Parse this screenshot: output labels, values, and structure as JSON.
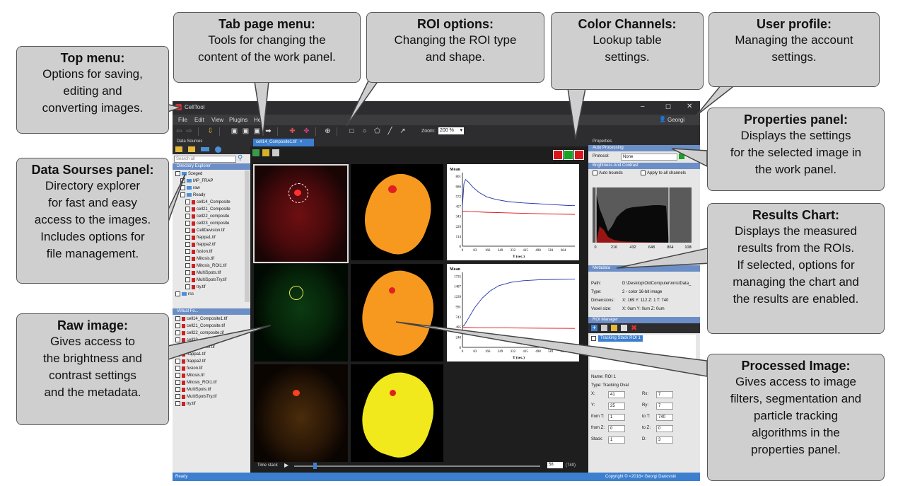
{
  "callouts": {
    "top_menu": {
      "title": "Top menu:",
      "lines": [
        "Options for saving,",
        "editing and",
        "converting images."
      ]
    },
    "tab_menu": {
      "title": "Tab page menu:",
      "lines": [
        "Tools for changing the",
        "content of the work panel."
      ]
    },
    "roi": {
      "title": "ROI options:",
      "lines": [
        "Changing the ROI type",
        "and shape."
      ]
    },
    "color": {
      "title": "Color Channels:",
      "lines": [
        "Lookup table",
        "settings."
      ]
    },
    "user": {
      "title": "User profile:",
      "lines": [
        "Managing the account",
        "settings."
      ]
    },
    "props": {
      "title": "Properties panel:",
      "lines": [
        "Displays the settings",
        "for the selected image in",
        "the work panel."
      ]
    },
    "datasrc": {
      "title": "Data Sourses panel:",
      "lines": [
        "Directory explorer",
        "for fast and easy",
        "access to the images.",
        "Includes options for",
        "file management."
      ]
    },
    "results": {
      "title": "Results Chart:",
      "lines": [
        "Displays the measured",
        "results from the ROIs.",
        "If selected, options for",
        "managing the chart and",
        "the results are enabled."
      ]
    },
    "raw": {
      "title": "Raw image:",
      "lines": [
        "Gives access to",
        "the brightness and",
        "contrast settings",
        "and the metadata."
      ]
    },
    "processed": {
      "title": "Processed Image:",
      "lines": [
        "Gives access to image",
        "filters, segmentation and",
        "particle tracking",
        "algorithms in the",
        "properties panel."
      ]
    }
  },
  "app": {
    "title": "CellTool",
    "menu": [
      "File",
      "Edit",
      "View",
      "Plugins",
      "He"
    ],
    "user": "Georgi",
    "zoom_label": "Zoom:",
    "zoom_value": "200 %",
    "data_sources_label": "Data Sources",
    "search_placeholder": "Search all",
    "directory_explorer": "Directory Explorer",
    "tree": [
      {
        "label": "Szeged",
        "type": "folder",
        "indent": 0
      },
      {
        "label": "MP_FRAP",
        "type": "folder",
        "indent": 1
      },
      {
        "label": "raw",
        "type": "folder",
        "indent": 1
      },
      {
        "label": "Ready",
        "type": "folder",
        "indent": 1
      },
      {
        "label": "cell14_Composite",
        "type": "file",
        "indent": 2
      },
      {
        "label": "cell21_Composite",
        "type": "file",
        "indent": 2
      },
      {
        "label": "cell22_composite",
        "type": "file",
        "indent": 2
      },
      {
        "label": "cell23_composite",
        "type": "file",
        "indent": 2
      },
      {
        "label": "CellDevision.tif",
        "type": "file",
        "indent": 2
      },
      {
        "label": "frappa1.tif",
        "type": "file",
        "indent": 2
      },
      {
        "label": "frappa2.tif",
        "type": "file",
        "indent": 2
      },
      {
        "label": "fusion.tif",
        "type": "file",
        "indent": 2
      },
      {
        "label": "Mitosis.tif",
        "type": "file",
        "indent": 2
      },
      {
        "label": "Mitosis_ROI1.tif",
        "type": "file",
        "indent": 2
      },
      {
        "label": "MultiSpots.tif",
        "type": "file",
        "indent": 2
      },
      {
        "label": "MultiSpotsTry.tif",
        "type": "file",
        "indent": 2
      },
      {
        "label": "try.tif",
        "type": "file",
        "indent": 2
      },
      {
        "label": "rss",
        "type": "folder",
        "indent": 0
      }
    ],
    "virtual_label": "Virtual Fo...",
    "virtual_files": [
      "cell14_Composite1.tif",
      "cell21_Composite.tif",
      "cell22_composite.tif",
      "cell23_composite.tif",
      "CellDevision.tif",
      "frappa1.tif",
      "frappa2.tif",
      "fusion.tif",
      "Mitosis.tif",
      "Mitosis_ROI1.tif",
      "MultiSpots.tif",
      "MultiSpotsTry.tif",
      "try.tif"
    ],
    "tab_label": "cell14_Composite1.tif",
    "time_stack_label": "Time stack",
    "frame_value": "58",
    "frame_total": "(740)",
    "status": "Ready",
    "copyright": "Copyright © <2018> Georgi Danovski",
    "colors": {
      "channel_red": "#d9161a",
      "channel_green": "#17a323",
      "accent": "#3d7fcf"
    },
    "properties": {
      "header": "Properties",
      "auto_processing": "Auto Processing",
      "protocol_label": "Protocol:",
      "protocol_value": "None",
      "brightness": "Brightness And Contrast",
      "auto_bounds": "Auto bounds",
      "apply_all": "Apply to all channels",
      "metadata": "Metadata",
      "path_label": "Path:",
      "path_value": "D:\\Desktop\\OldComputer\\nnis\\Data_",
      "type_label": "Type:",
      "type_value": "2 - color 16-bit image",
      "dim_label": "Dimensions:",
      "dim_value": "X: 169   Y: 112   Z: 1   T: 740",
      "voxel_label": "Voxel size:",
      "voxel_value": "X: 0um   Y: 0um   Z: 0um",
      "roi_manager": "ROI Manager",
      "roi_item": "Tracking Stack ROI 1",
      "name_label": "Name: ROI 1",
      "roi_type": "Type: Tracking Oval",
      "fields": [
        {
          "l": "X:",
          "v": "41",
          "l2": "Rx:",
          "v2": "7"
        },
        {
          "l": "Y:",
          "v": "25",
          "l2": "Ry:",
          "v2": "7"
        },
        {
          "l": "from T:",
          "v": "1",
          "l2": "to T:",
          "v2": "740"
        },
        {
          "l": "from Z:",
          "v": "0",
          "l2": "to Z:",
          "v2": "0"
        },
        {
          "l": "Stack:",
          "v": "1",
          "l2": "D:",
          "v2": "3"
        }
      ]
    }
  },
  "chart_data": [
    {
      "type": "histogram",
      "title": "",
      "xticks": [
        "0",
        "216",
        "432",
        "648",
        "864",
        "1080"
      ],
      "xlim": [
        0,
        1080
      ],
      "note": "brightness histogram with red overlay"
    },
    {
      "type": "line",
      "title": "Mean",
      "xlabel": "T (sec.)",
      "xticks": [
        "0",
        "83",
        "166",
        "249",
        "332",
        "415",
        "498",
        "581",
        "664"
      ],
      "yticks": [
        "0",
        "114",
        "229",
        "343",
        "457",
        "572",
        "686",
        "801"
      ],
      "xlim": [
        0,
        740
      ],
      "ylim": [
        0,
        850
      ],
      "series": [
        {
          "color": "#2233aa",
          "x": [
            0,
            10,
            20,
            40,
            70,
            110,
            160,
            220,
            300,
            400,
            500,
            600,
            700,
            740
          ],
          "y": [
            460,
            720,
            770,
            740,
            680,
            620,
            570,
            540,
            515,
            500,
            490,
            480,
            470,
            468
          ]
        },
        {
          "color": "#d11",
          "x": [
            0,
            10,
            50,
            150,
            300,
            450,
            600,
            740
          ],
          "y": [
            400,
            405,
            400,
            392,
            385,
            378,
            372,
            368
          ]
        }
      ]
    },
    {
      "type": "line",
      "title": "Mean",
      "xlabel": "T (sec.)",
      "xticks": [
        "0",
        "83",
        "166",
        "249",
        "332",
        "415",
        "498",
        "581",
        "664"
      ],
      "yticks": [
        "0",
        "248",
        "495",
        "743",
        "991",
        "1239",
        "1487",
        "1735"
      ],
      "xlim": [
        0,
        740
      ],
      "ylim": [
        0,
        1800
      ],
      "series": [
        {
          "color": "#2233aa",
          "x": [
            0,
            10,
            40,
            80,
            130,
            180,
            240,
            320,
            400,
            500,
            600,
            700,
            740
          ],
          "y": [
            500,
            520,
            700,
            950,
            1180,
            1350,
            1480,
            1560,
            1600,
            1620,
            1630,
            1635,
            1640
          ]
        },
        {
          "color": "#d11",
          "x": [
            0,
            10,
            100,
            300,
            500,
            740
          ],
          "y": [
            470,
            475,
            470,
            465,
            460,
            455
          ]
        }
      ]
    }
  ]
}
